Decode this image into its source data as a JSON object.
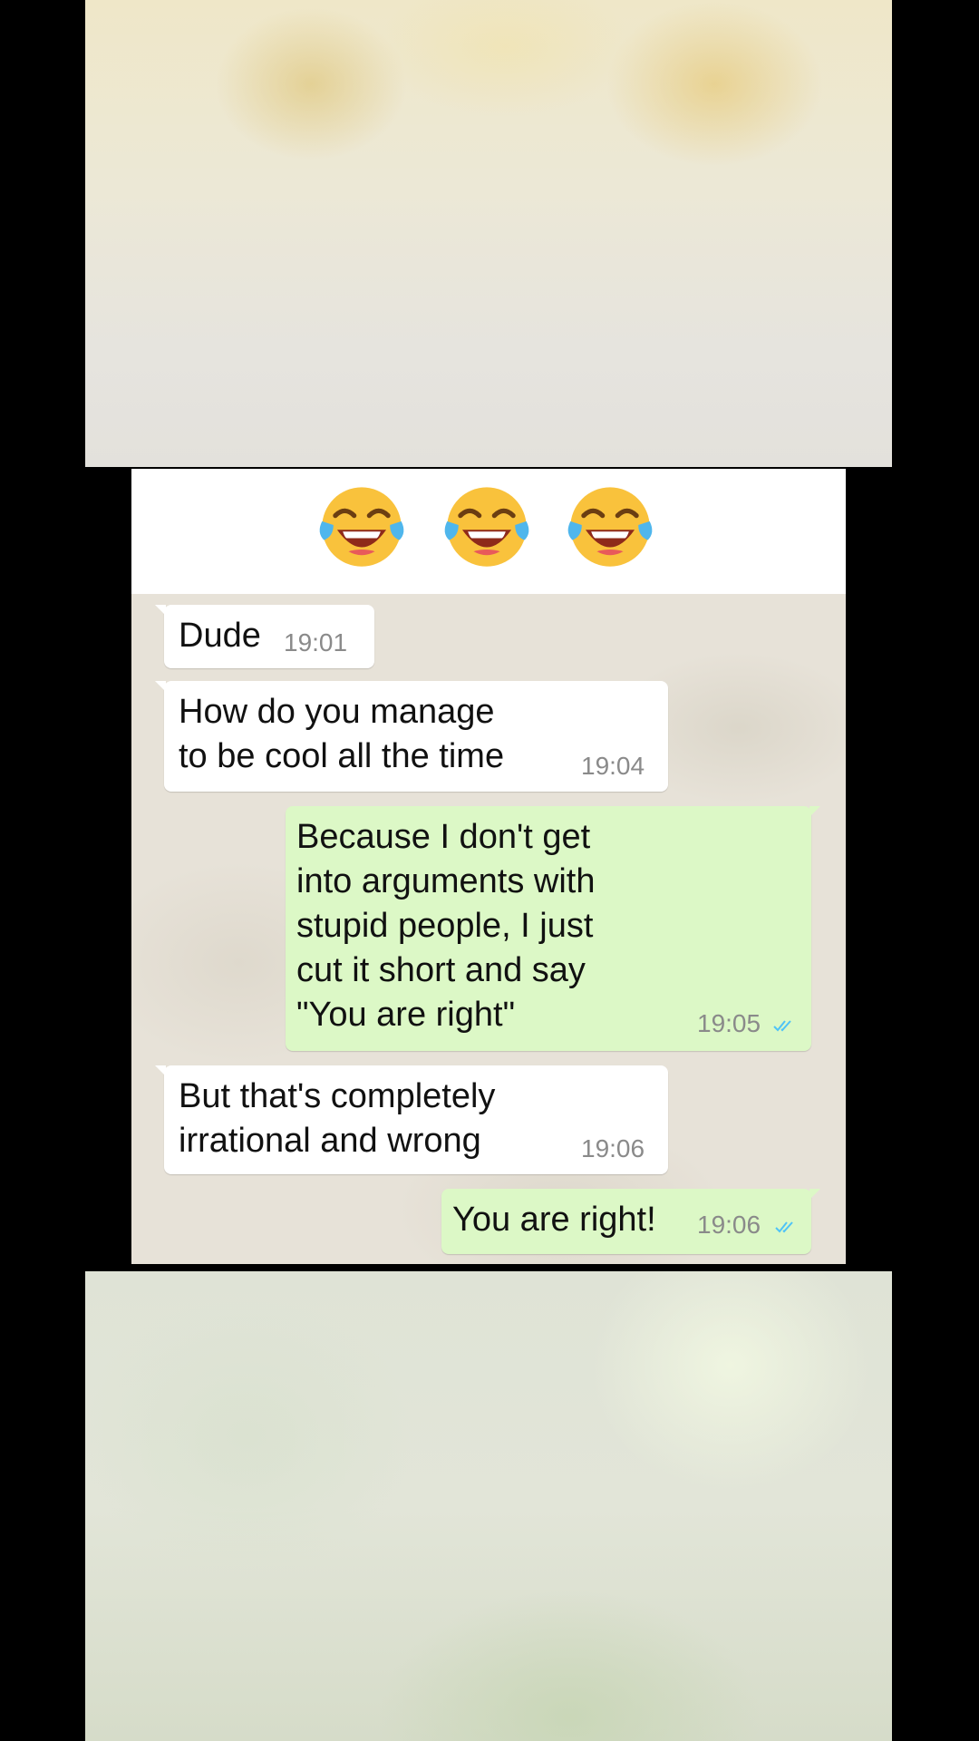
{
  "header": {
    "emojis": [
      "face-with-tears-of-joy",
      "face-with-tears-of-joy",
      "face-with-tears-of-joy"
    ]
  },
  "messages": [
    {
      "direction": "incoming",
      "text": "Dude",
      "time": "19:01"
    },
    {
      "direction": "incoming",
      "text": "How do you manage\nto be cool all the time",
      "time": "19:04"
    },
    {
      "direction": "outgoing",
      "text": "Because I don't get\ninto arguments with\nstupid people, I just\ncut it short and say\n\"You are right\"",
      "time": "19:05",
      "status": "read"
    },
    {
      "direction": "incoming",
      "text": "But that's completely\nirrational and wrong",
      "time": "19:06"
    },
    {
      "direction": "outgoing",
      "text": "You are right!",
      "time": "19:06",
      "status": "read"
    }
  ],
  "colors": {
    "incoming_bubble": "#ffffff",
    "outgoing_bubble": "#dcf8c6",
    "chat_wallpaper": "#e7e2d8",
    "read_ticks": "#4fc3f7",
    "timestamp": "#8a8a8a"
  }
}
